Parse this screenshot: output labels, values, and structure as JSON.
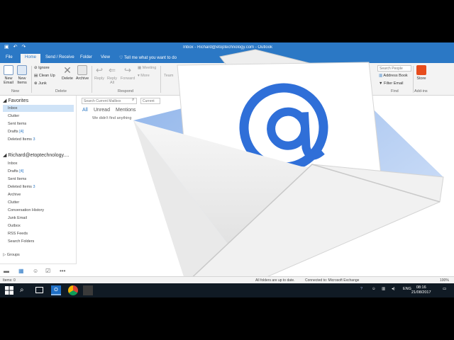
{
  "title_bar": {
    "title": "Inbox - Richard@etoptechnology.com - Outlook",
    "qat": [
      "save-icon",
      "undo-icon",
      "redo-icon"
    ]
  },
  "tabs": [
    {
      "label": "File",
      "active": false
    },
    {
      "label": "Home",
      "active": true
    },
    {
      "label": "Send / Receive",
      "active": false
    },
    {
      "label": "Folder",
      "active": false
    },
    {
      "label": "View",
      "active": false
    }
  ],
  "tell_me": "Tell me what you want to do",
  "ribbon": {
    "new_email": "New Email",
    "new_items": "New Items",
    "ignore": "Ignore",
    "clean_up": "Clean Up",
    "junk": "Junk",
    "delete": "Delete",
    "archive": "Archive",
    "reply": "Reply",
    "reply_all": "Reply All",
    "forward": "Forward",
    "meeting": "Meeting",
    "team": "Team",
    "more": "More",
    "search_people_placeholder": "Search People",
    "address_book": "Address Book",
    "filter_email": "Filter Email",
    "store": "Store",
    "groups": {
      "new": "New",
      "delete": "Delete",
      "respond": "Respond",
      "find": "Find",
      "addins": "Add-ins"
    }
  },
  "favorites": {
    "header": "Favorites",
    "items": [
      {
        "label": "Inbox",
        "selected": true,
        "count": ""
      },
      {
        "label": "Clutter",
        "selected": false,
        "count": ""
      },
      {
        "label": "Sent Items",
        "selected": false,
        "count": ""
      },
      {
        "label": "Drafts",
        "selected": false,
        "count": "[4]"
      },
      {
        "label": "Deleted Items",
        "selected": false,
        "count": "3"
      }
    ]
  },
  "account": {
    "header": "Richard@etoptechnology....",
    "items": [
      {
        "label": "Inbox",
        "count": ""
      },
      {
        "label": "Drafts",
        "count": "[4]"
      },
      {
        "label": "Sent Items",
        "count": ""
      },
      {
        "label": "Deleted Items",
        "count": "3"
      },
      {
        "label": "Archive",
        "count": ""
      },
      {
        "label": "Clutter",
        "count": ""
      },
      {
        "label": "Conversation History",
        "count": ""
      },
      {
        "label": "Junk Email",
        "count": ""
      },
      {
        "label": "Outbox",
        "count": ""
      },
      {
        "label": "RSS Feeds",
        "count": ""
      },
      {
        "label": "Search Folders",
        "count": ""
      }
    ]
  },
  "groups_header": "Groups",
  "mail_list": {
    "search_placeholder": "Search Current Mailbox",
    "scope": "Current",
    "filters": [
      "All",
      "Unread",
      "Mentions"
    ],
    "empty_message": "We didn't find anything"
  },
  "status": {
    "items": "Items: 0",
    "sync": "All folders are up to date.",
    "connection": "Connected to: Microsoft Exchange",
    "zoom": "100%"
  },
  "taskbar": {
    "lang": "ENG",
    "time": "08:16",
    "date": "21/08/2017"
  },
  "colors": {
    "accent": "#2b78c5",
    "at_sign": "#2f6fd8",
    "taskbar": "#101a24"
  }
}
